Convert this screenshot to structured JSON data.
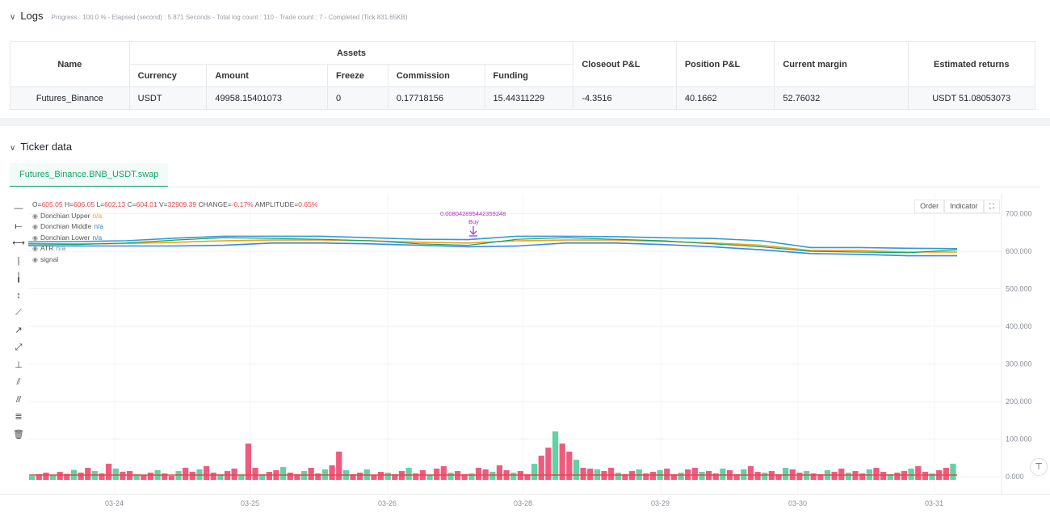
{
  "logs": {
    "title": "Logs",
    "meta": "Progress : 100.0 % - Elapsed (second) : 5.871  Seconds - Total log count : 110 - Trade count : 7 - Completed (Tick 831.65KB)",
    "table": {
      "group_header": "Assets",
      "headers": {
        "name": "Name",
        "currency": "Currency",
        "amount": "Amount",
        "freeze": "Freeze",
        "commission": "Commission",
        "funding": "Funding",
        "closeout": "Closeout P&L",
        "position": "Position P&L",
        "margin": "Current margin",
        "returns": "Estimated returns"
      },
      "row": {
        "name": "Futures_Binance",
        "currency": "USDT",
        "amount": "49958.15401073",
        "freeze": "0",
        "commission": "0.17718156",
        "funding": "15.44311229",
        "closeout": "-4.3516",
        "position": "40.1662",
        "margin": "52.76032",
        "returns": "USDT 51.08053073"
      }
    }
  },
  "ticker": {
    "title": "Ticker data",
    "tab": "Futures_Binance.BNB_USDT.swap",
    "buttons": {
      "order": "Order",
      "indicator": "Indicator"
    },
    "legend": {
      "ohlc": {
        "o_label": "O=",
        "o": "605.05",
        "h_label": "H=",
        "h": "606.05",
        "l_label": "L=",
        "l": "602.13",
        "c_label": "C=",
        "c": "604.01",
        "v_label": "V=",
        "v": "32909.39",
        "chg_label": "CHANGE=",
        "chg": "-0.17%",
        "amp_label": "AMPLITUDE=",
        "amp": "0.65%"
      },
      "items": [
        {
          "label": "Donchian Upper",
          "value": "n/a"
        },
        {
          "label": "Donchian Middle",
          "value": "n/a"
        },
        {
          "label": "Donchian Lower",
          "value": "n/a"
        },
        {
          "label": "ATR",
          "value": "n/a"
        },
        {
          "label": "signal",
          "value": ""
        }
      ]
    },
    "signal_annotation": {
      "value": "0.008042895442359248",
      "label": "Buy"
    },
    "toolbar_icons": [
      "horizontal-line-icon",
      "horizontal-ray-icon",
      "horizontal-segment-icon",
      "vertical-line-icon",
      "vertical-segment-icon",
      "vertical-range-icon",
      "trend-line-icon",
      "ray-icon",
      "extended-line-icon",
      "price-line-icon",
      "parallel-channel-icon",
      "multi-line-icon",
      "fibonacci-icon",
      "trash-icon"
    ]
  },
  "chart_data": {
    "type": "line",
    "x_ticks": [
      "03-24",
      "03-25",
      "03-26",
      "03-28",
      "03-29",
      "03-30",
      "03-31"
    ],
    "y_ticks": [
      "700.000",
      "600.000",
      "500.000",
      "400.000",
      "300.000",
      "200.000",
      "100.000",
      "0.000"
    ],
    "ylim": [
      -30,
      770
    ],
    "series": [
      {
        "name": "Donchian Upper",
        "color": "#2f9bd6",
        "values": [
          625,
          626,
          628,
          635,
          640,
          640,
          640,
          636,
          632,
          631,
          640,
          640,
          639,
          636,
          634,
          628,
          610,
          610,
          608,
          607
        ]
      },
      {
        "name": "Donchian Middle",
        "color": "#f59e0b",
        "values": [
          620,
          620,
          621,
          624,
          628,
          630,
          630,
          628,
          624,
          622,
          628,
          630,
          630,
          626,
          622,
          616,
          602,
          602,
          598,
          598
        ]
      },
      {
        "name": "Donchian Lower",
        "color": "#3b82f6",
        "values": [
          615,
          614,
          614,
          614,
          616,
          622,
          622,
          620,
          616,
          612,
          614,
          622,
          622,
          618,
          612,
          604,
          594,
          592,
          588,
          588
        ]
      },
      {
        "name": "Close",
        "color": "#13a36b",
        "values": [
          620,
          618,
          622,
          630,
          636,
          634,
          632,
          628,
          620,
          616,
          632,
          636,
          632,
          628,
          620,
          612,
          600,
          598,
          596,
          604
        ]
      }
    ],
    "volume": [
      10,
      14,
      18,
      12,
      20,
      15,
      25,
      18,
      30,
      22,
      16,
      40,
      28,
      20,
      22,
      14,
      12,
      18,
      24,
      16,
      10,
      22,
      30,
      20,
      26,
      34,
      18,
      14,
      22,
      28,
      12,
      90,
      30,
      14,
      20,
      24,
      32,
      18,
      14,
      22,
      30,
      16,
      26,
      36,
      70,
      24,
      14,
      18,
      26,
      12,
      20,
      18,
      14,
      22,
      30,
      16,
      24,
      12,
      28,
      34,
      18,
      22,
      14,
      16,
      30,
      26,
      20,
      36,
      24,
      18,
      22,
      14,
      40,
      60,
      80,
      120,
      90,
      70,
      50,
      30,
      28,
      26,
      22,
      30,
      18,
      14,
      22,
      26,
      16,
      20,
      24,
      28,
      14,
      18,
      26,
      30,
      20,
      22,
      16,
      28,
      24,
      14,
      26,
      34,
      20,
      18,
      22,
      14,
      30,
      26,
      18,
      22,
      16,
      14,
      24,
      20,
      28,
      18,
      22,
      16,
      26,
      30,
      20,
      14,
      18,
      22,
      28,
      34,
      20,
      16,
      24,
      30,
      40
    ]
  }
}
